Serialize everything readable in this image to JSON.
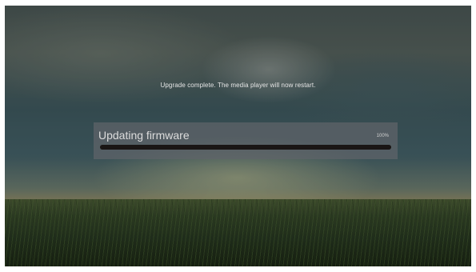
{
  "dialog": {
    "message": "Upgrade complete. The media player will now restart.",
    "progress_title": "Updating firmware",
    "progress_percent_text": "100%",
    "progress_value": 1.0
  },
  "colors": {
    "panel": "#5f6469",
    "track": "#2a2422",
    "text": "#e6e6e6"
  }
}
